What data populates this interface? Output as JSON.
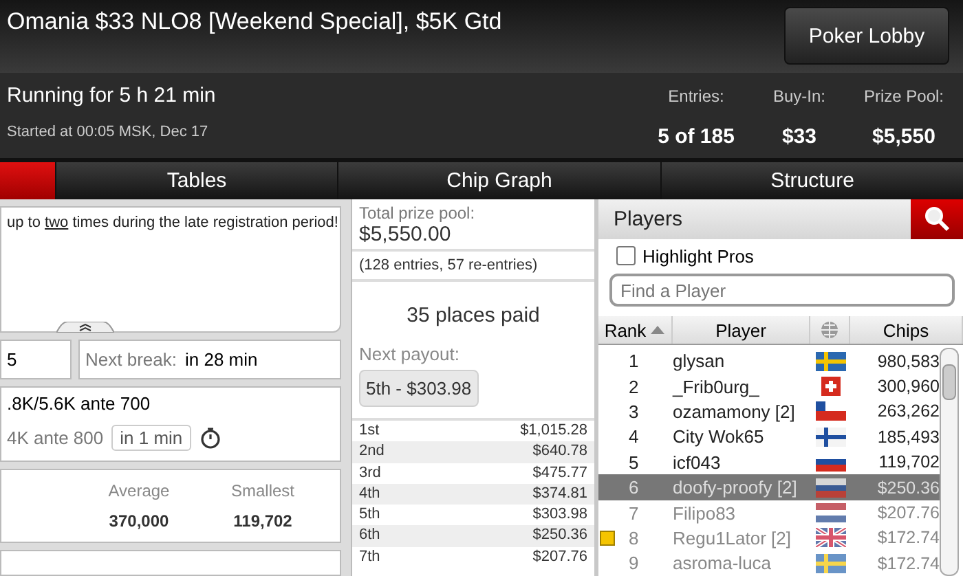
{
  "header": {
    "title": "Omania $33 NLO8 [Weekend Special], $5K Gtd",
    "lobby_button": "Poker Lobby"
  },
  "info": {
    "running": "Running for 5 h 21 min",
    "started": "Started at 00:05 MSK, Dec 17",
    "stats": [
      {
        "label": "Entries:",
        "value": "5 of 185"
      },
      {
        "label": "Buy-In:",
        "value": "$33"
      },
      {
        "label": "Prize Pool:",
        "value": "$5,550"
      }
    ]
  },
  "tabs": [
    {
      "selected": true
    },
    {
      "label": "Tables",
      "selected": false
    },
    {
      "label": "Chip Graph",
      "selected": false
    },
    {
      "label": "Structure",
      "selected": false
    }
  ],
  "message": {
    "before": "up to ",
    "link": "two",
    "after": " times during the late registration period!"
  },
  "level_row": {
    "level": "5",
    "next_break_label": "Next break:",
    "next_break": "in 28 min"
  },
  "blinds": {
    "current": ".8K/5.6K ante 700",
    "next": "4K ante 800",
    "next_in": "in 1 min"
  },
  "stacks": [
    {
      "label": "Average",
      "value": "370,000"
    },
    {
      "label": "Smallest",
      "value": "119,702"
    }
  ],
  "prizes": {
    "total_label": "Total prize pool:",
    "total": "$5,550.00",
    "entries": "(128 entries, 57 re-entries)",
    "places_paid": "35 places paid",
    "next_payout_label": "Next payout:",
    "next_payout": "5th - $303.98",
    "payouts": [
      {
        "place": "1st",
        "amount": "$1,015.28"
      },
      {
        "place": "2nd",
        "amount": "$640.78"
      },
      {
        "place": "3rd",
        "amount": "$475.77"
      },
      {
        "place": "4th",
        "amount": "$374.81"
      },
      {
        "place": "5th",
        "amount": "$303.98"
      },
      {
        "place": "6th",
        "amount": "$250.36"
      },
      {
        "place": "7th",
        "amount": "$207.76"
      }
    ]
  },
  "players": {
    "title": "Players",
    "highlight_pros": {
      "label": "Highlight Pros",
      "checked": false
    },
    "search": {
      "placeholder": "Find a Player"
    },
    "columns": [
      "Rank",
      "Player",
      "Chips"
    ],
    "rows": [
      {
        "rank": "1",
        "name": "glysan",
        "flag": {
          "kind": "sweden"
        },
        "chips": "980,583",
        "eliminated": false,
        "selected": false,
        "marked": false
      },
      {
        "rank": "2",
        "name": "_Frib0urg_",
        "flag": {
          "kind": "switzerland"
        },
        "chips": "300,960",
        "eliminated": false,
        "selected": false,
        "marked": false
      },
      {
        "rank": "3",
        "name": "ozamamony [2]",
        "flag": {
          "kind": "chile"
        },
        "chips": "263,262",
        "eliminated": false,
        "selected": false,
        "marked": false
      },
      {
        "rank": "4",
        "name": "City Wok65",
        "flag": {
          "kind": "finland"
        },
        "chips": "185,493",
        "eliminated": false,
        "selected": false,
        "marked": false
      },
      {
        "rank": "5",
        "name": "icf043",
        "flag": {
          "kind": "russia"
        },
        "chips": "119,702",
        "eliminated": false,
        "selected": false,
        "marked": false
      },
      {
        "rank": "6",
        "name": "doofy-proofy [2]",
        "flag": {
          "kind": "russia"
        },
        "chips": "$250.36",
        "eliminated": true,
        "selected": true,
        "marked": false
      },
      {
        "rank": "7",
        "name": "Filipo83",
        "flag": {
          "kind": "netherlands"
        },
        "chips": "$207.76",
        "eliminated": true,
        "selected": false,
        "marked": false
      },
      {
        "rank": "8",
        "name": "Regu1Lator [2]",
        "flag": {
          "kind": "britain"
        },
        "chips": "$172.74",
        "eliminated": true,
        "selected": false,
        "marked": true
      },
      {
        "rank": "9",
        "name": "asroma-luca",
        "flag": {
          "kind": "sweden"
        },
        "chips": "$172.74",
        "eliminated": true,
        "selected": false,
        "marked": false
      }
    ]
  }
}
